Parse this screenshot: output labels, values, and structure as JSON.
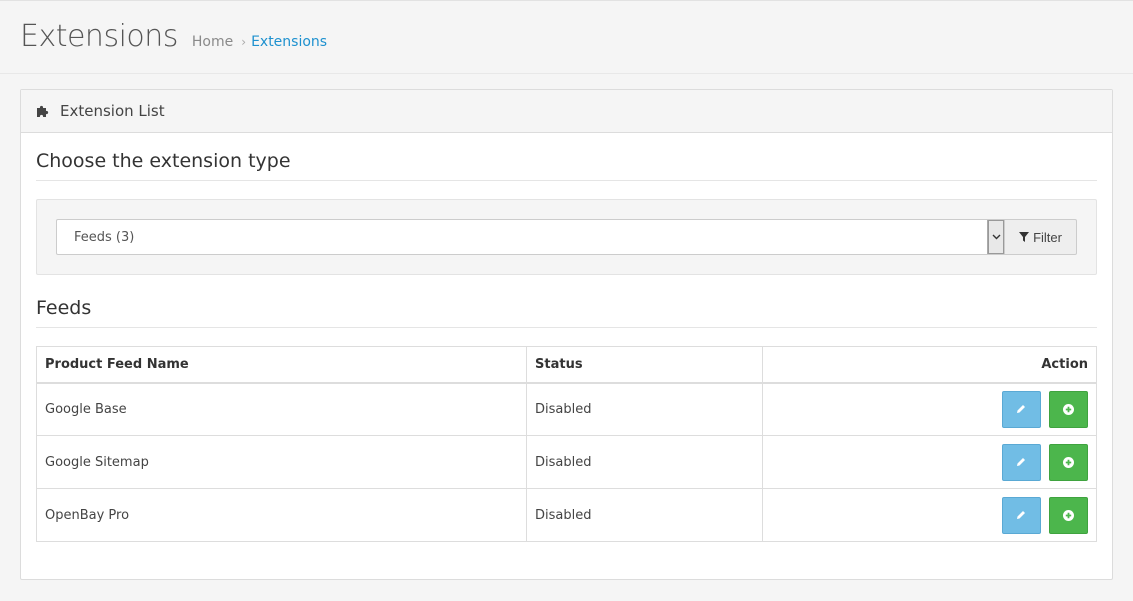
{
  "header": {
    "title": "Extensions",
    "breadcrumb": {
      "home": "Home",
      "separator": "›",
      "current": "Extensions"
    }
  },
  "panel": {
    "heading_icon": "puzzle-piece-icon",
    "heading": "Extension List",
    "choose_title": "Choose the extension type",
    "select_value": "Feeds (3)",
    "filter_label": "Filter",
    "feeds_title": "Feeds"
  },
  "table": {
    "columns": [
      "Product Feed Name",
      "Status",
      "Action"
    ],
    "rows": [
      {
        "name": "Google Base",
        "status": "Disabled"
      },
      {
        "name": "Google Sitemap",
        "status": "Disabled"
      },
      {
        "name": "OpenBay Pro",
        "status": "Disabled"
      }
    ],
    "edit_icon": "pencil-icon",
    "install_icon": "plus-circle-icon"
  },
  "colors": {
    "accent_link": "#1e91cf",
    "edit_button": "#71bde5",
    "install_button": "#4cb64c"
  }
}
